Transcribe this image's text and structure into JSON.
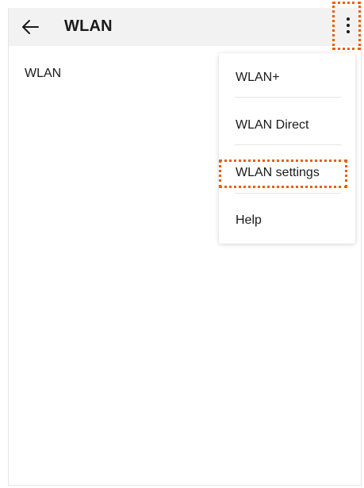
{
  "appbar": {
    "title": "WLAN",
    "back_icon": "arrow-left-icon",
    "more_icon": "more-vertical-icon"
  },
  "main": {
    "row_label": "WLAN"
  },
  "menu": {
    "items": [
      {
        "label": "WLAN+"
      },
      {
        "label": "WLAN Direct"
      },
      {
        "label": "WLAN settings"
      },
      {
        "label": "Help"
      }
    ]
  },
  "colors": {
    "highlight": "#e8600a",
    "appbar_bg": "#f2f2f2"
  }
}
